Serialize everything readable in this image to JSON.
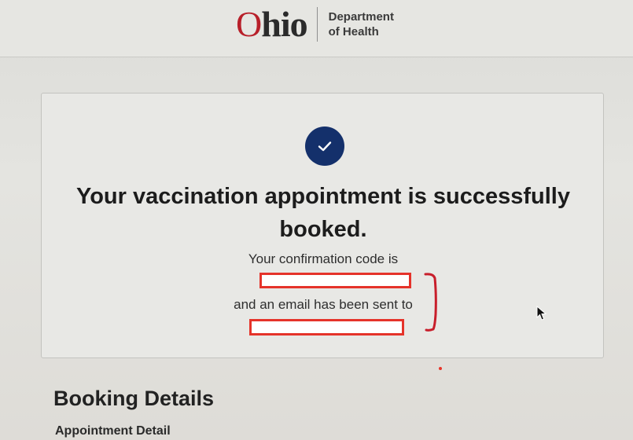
{
  "header": {
    "logo_text": "Ohio",
    "dept_line1": "Department",
    "dept_line2": "of Health"
  },
  "confirmation": {
    "icon": "checkmark-icon",
    "title": "Your vaccination appointment is successfully booked.",
    "code_text": "Your confirmation code is",
    "email_text": "and an email has been sent to"
  },
  "booking": {
    "title": "Booking Details",
    "appointment_detail": "Appointment Detail"
  },
  "colors": {
    "ohio_red": "#b8202a",
    "check_navy": "#14306b",
    "redaction_red": "#e5332a"
  }
}
